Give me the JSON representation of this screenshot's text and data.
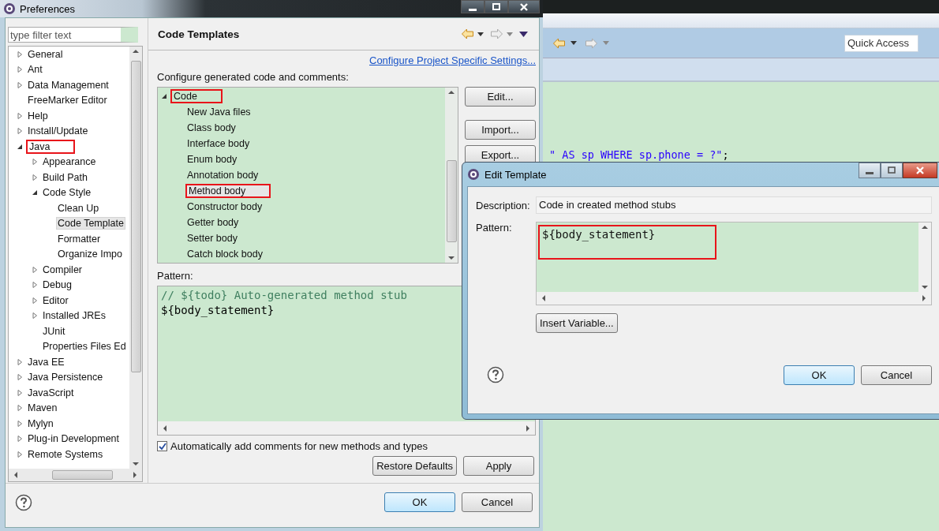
{
  "preferences": {
    "title": "Preferences",
    "filter_placeholder": "type filter text",
    "tree": [
      {
        "label": "General",
        "expanded": false,
        "selected": false,
        "highlighted": false
      },
      {
        "label": "Ant",
        "expanded": false,
        "selected": false,
        "highlighted": false
      },
      {
        "label": "Data Management",
        "expanded": false,
        "selected": false,
        "highlighted": false
      },
      {
        "label": "FreeMarker Editor",
        "selected": false,
        "highlighted": false
      },
      {
        "label": "Help",
        "expanded": false,
        "selected": false,
        "highlighted": false
      },
      {
        "label": "Install/Update",
        "expanded": false,
        "selected": false,
        "highlighted": false
      },
      {
        "label": "Java",
        "expanded": true,
        "selected": false,
        "highlighted": true,
        "children": [
          {
            "label": "Appearance",
            "expanded": false,
            "selected": false,
            "highlighted": false
          },
          {
            "label": "Build Path",
            "expanded": false,
            "selected": false,
            "highlighted": false
          },
          {
            "label": "Code Style",
            "expanded": true,
            "selected": false,
            "highlighted": false,
            "children": [
              {
                "label": "Clean Up",
                "selected": false,
                "highlighted": false
              },
              {
                "label": "Code Template",
                "selected": true,
                "highlighted": false
              },
              {
                "label": "Formatter",
                "selected": false,
                "highlighted": false
              },
              {
                "label": "Organize Impo",
                "selected": false,
                "highlighted": false
              }
            ]
          },
          {
            "label": "Compiler",
            "expanded": false,
            "selected": false,
            "highlighted": false
          },
          {
            "label": "Debug",
            "expanded": false,
            "selected": false,
            "highlighted": false
          },
          {
            "label": "Editor",
            "expanded": false,
            "selected": false,
            "highlighted": false
          },
          {
            "label": "Installed JREs",
            "expanded": false,
            "selected": false,
            "highlighted": false
          },
          {
            "label": "JUnit",
            "selected": false,
            "highlighted": false
          },
          {
            "label": "Properties Files Ed",
            "selected": false,
            "highlighted": false
          }
        ]
      },
      {
        "label": "Java EE",
        "expanded": false,
        "selected": false,
        "highlighted": false
      },
      {
        "label": "Java Persistence",
        "expanded": false,
        "selected": false,
        "highlighted": false
      },
      {
        "label": "JavaScript",
        "expanded": false,
        "selected": false,
        "highlighted": false
      },
      {
        "label": "Maven",
        "expanded": false,
        "selected": false,
        "highlighted": false
      },
      {
        "label": "Mylyn",
        "expanded": false,
        "selected": false,
        "highlighted": false
      },
      {
        "label": "Plug-in Development",
        "expanded": false,
        "selected": false,
        "highlighted": false
      },
      {
        "label": "Remote Systems",
        "expanded": false,
        "selected": false,
        "highlighted": false
      }
    ],
    "page": {
      "title": "Code Templates",
      "link": "Configure Project Specific Settings...",
      "label": "Configure generated code and comments:",
      "templates": [
        {
          "label": "Code",
          "expanded": true,
          "selected": false,
          "highlighted": true,
          "children": [
            {
              "label": "New Java files",
              "selected": false,
              "highlighted": false
            },
            {
              "label": "Class body",
              "selected": false,
              "highlighted": false
            },
            {
              "label": "Interface body",
              "selected": false,
              "highlighted": false
            },
            {
              "label": "Enum body",
              "selected": false,
              "highlighted": false
            },
            {
              "label": "Annotation body",
              "selected": false,
              "highlighted": false
            },
            {
              "label": "Method body",
              "selected": true,
              "highlighted": true
            },
            {
              "label": "Constructor body",
              "selected": false,
              "highlighted": false
            },
            {
              "label": "Getter body",
              "selected": false,
              "highlighted": false
            },
            {
              "label": "Setter body",
              "selected": false,
              "highlighted": false
            },
            {
              "label": "Catch block body",
              "selected": false,
              "highlighted": false
            }
          ]
        }
      ],
      "buttons": [
        "Edit...",
        "Import...",
        "Export..."
      ],
      "pattern_label": "Pattern:",
      "pattern_lines": [
        {
          "kind": "comment",
          "text": "// ${todo} Auto-generated method stub"
        },
        {
          "kind": "code",
          "text": "${body_statement}"
        }
      ],
      "checkbox": {
        "label": "Automatically add comments for new methods and types",
        "checked": true
      },
      "actions": [
        "Restore Defaults",
        "Apply"
      ]
    },
    "footer_buttons": [
      {
        "label": "OK",
        "default": true
      },
      {
        "label": "Cancel",
        "default": false
      }
    ]
  },
  "editor": {
    "placeholder": "Quick Access",
    "code_line": [
      {
        "kind": "string",
        "text": "\" AS sp WHERE sp.phone = ?\""
      },
      {
        "kind": "plain",
        "text": ";"
      }
    ]
  },
  "edit_template": {
    "title": "Edit Template",
    "description_label": "Description:",
    "description": "Code in created method stubs",
    "pattern_label": "Pattern:",
    "pattern": "${body_statement}",
    "pattern_highlighted": true,
    "insert_button": "Insert Variable...",
    "buttons": [
      {
        "label": "OK",
        "default": true
      },
      {
        "label": "Cancel",
        "default": false
      }
    ]
  }
}
